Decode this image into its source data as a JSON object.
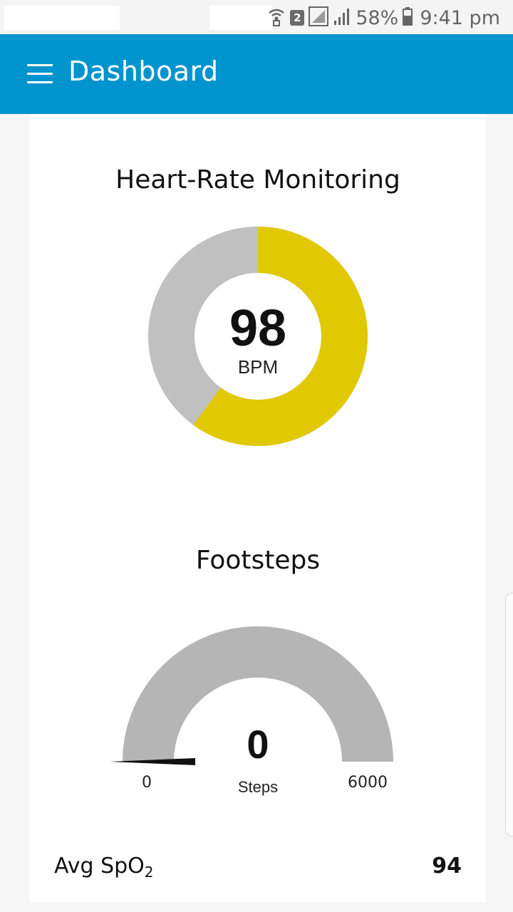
{
  "status_bar": {
    "sim_badge": "2",
    "battery": "58%",
    "time": "9:41 pm"
  },
  "app_bar": {
    "title": "Dashboard"
  },
  "heart_rate": {
    "title": "Heart-Rate Monitoring",
    "value": "98",
    "unit": "BPM",
    "fill_fraction": 0.6,
    "fill_color": "#e0c900",
    "track_color": "#c0c0c0"
  },
  "footsteps": {
    "title": "Footsteps",
    "value": "0",
    "unit": "Steps",
    "min_label": "0",
    "max_label": "6000",
    "min": 0,
    "max": 6000,
    "current": 0,
    "track_color": "#b5b5b5",
    "needle_color": "#111111"
  },
  "spo2": {
    "label_main": "Avg SpO",
    "label_sub": "2",
    "value": "94"
  }
}
